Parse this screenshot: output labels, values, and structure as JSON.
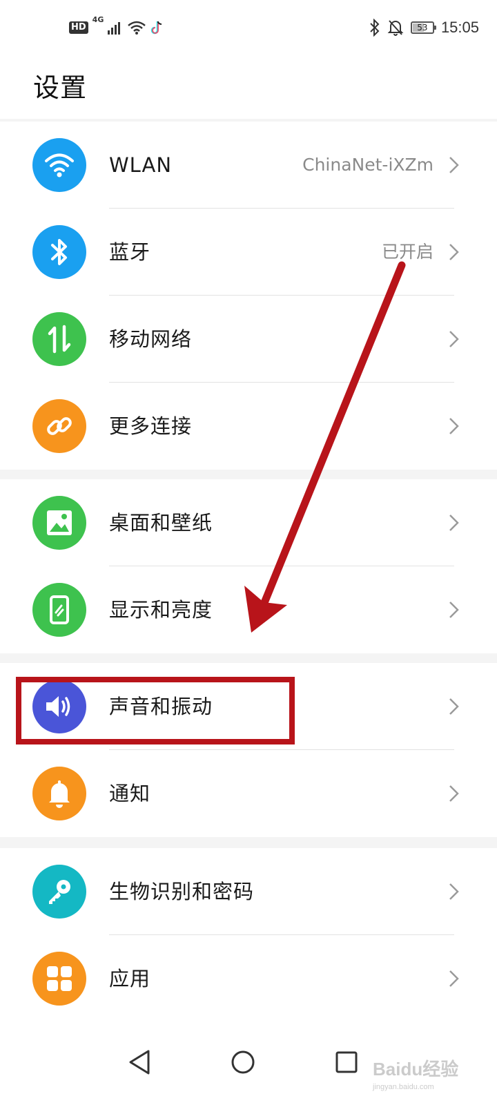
{
  "status_bar": {
    "hd_badge": "HD",
    "network_type": "4G",
    "battery_level": "53",
    "battery_fraction": 0.53,
    "time": "15:05"
  },
  "header": {
    "title": "设置"
  },
  "groups": [
    {
      "items": [
        {
          "label": "WLAN",
          "value": "ChinaNet-iXZm",
          "icon": "wifi-icon",
          "color": "#1aa0f0"
        },
        {
          "label": "蓝牙",
          "value": "已开启",
          "icon": "bluetooth-icon",
          "color": "#1aa0f0"
        },
        {
          "label": "移动网络",
          "value": "",
          "icon": "mobile-data-icon",
          "color": "#3ec24e"
        },
        {
          "label": "更多连接",
          "value": "",
          "icon": "link-icon",
          "color": "#f7941d"
        }
      ]
    },
    {
      "items": [
        {
          "label": "桌面和壁纸",
          "value": "",
          "icon": "wallpaper-icon",
          "color": "#3ec24e"
        },
        {
          "label": "显示和亮度",
          "value": "",
          "icon": "display-icon",
          "color": "#3ec24e"
        }
      ]
    },
    {
      "items": [
        {
          "label": "声音和振动",
          "value": "",
          "icon": "sound-icon",
          "color": "#4a55d8"
        },
        {
          "label": "通知",
          "value": "",
          "icon": "bell-icon",
          "color": "#f7941d"
        }
      ]
    },
    {
      "items": [
        {
          "label": "生物识别和密码",
          "value": "",
          "icon": "key-icon",
          "color": "#14b8c4"
        },
        {
          "label": "应用",
          "value": "",
          "icon": "apps-icon",
          "color": "#f7941d"
        }
      ]
    }
  ],
  "annotation": {
    "color": "#b8141a"
  },
  "watermark": {
    "text": "Baidu经验",
    "sub": "jingyan.baidu.com"
  }
}
